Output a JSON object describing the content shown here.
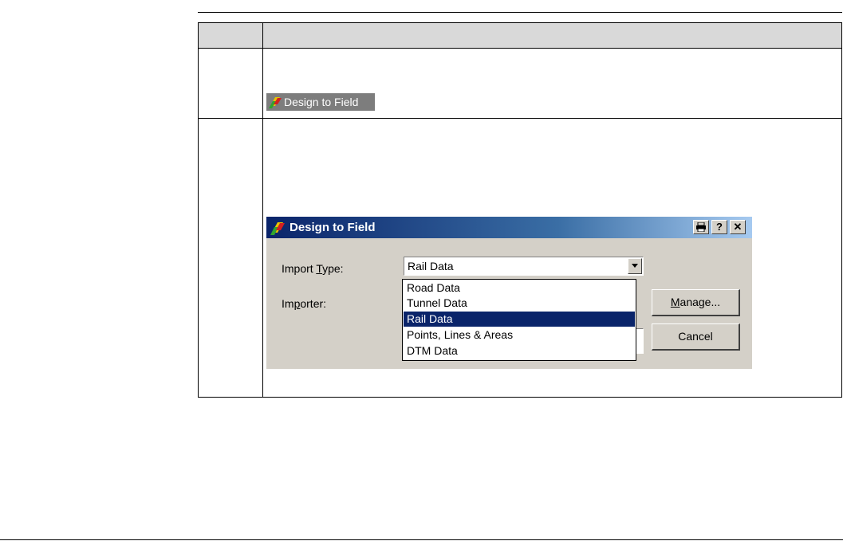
{
  "launcher": {
    "label": "Design to Field",
    "icon": "design-to-field-icon"
  },
  "dialog": {
    "title": "Design to Field",
    "icon": "design-to-field-icon",
    "titlebar_buttons": [
      "print-icon",
      "help-icon",
      "close-icon"
    ],
    "import_type": {
      "label_before": "Import ",
      "label_accel": "T",
      "label_after": "ype:",
      "value": "Rail Data"
    },
    "importer": {
      "label_before": "Im",
      "label_accel": "p",
      "label_after": "orter:",
      "value": ""
    },
    "dropdown_options": [
      {
        "label": "Road Data",
        "selected": false
      },
      {
        "label": "Tunnel Data",
        "selected": false
      },
      {
        "label": "Rail Data",
        "selected": true
      },
      {
        "label": "Points, Lines & Areas",
        "selected": false
      },
      {
        "label": "DTM Data",
        "selected": false
      }
    ],
    "manage_button": {
      "accel": "M",
      "rest": "anage..."
    },
    "cancel_button": {
      "label": "Cancel"
    }
  },
  "colors": {
    "titlebar_start": "#0a246a",
    "titlebar_end": "#a6caf0",
    "dialog_face": "#d4d0c8",
    "selection": "#0a246a",
    "table_header": "#d9d9d9"
  }
}
